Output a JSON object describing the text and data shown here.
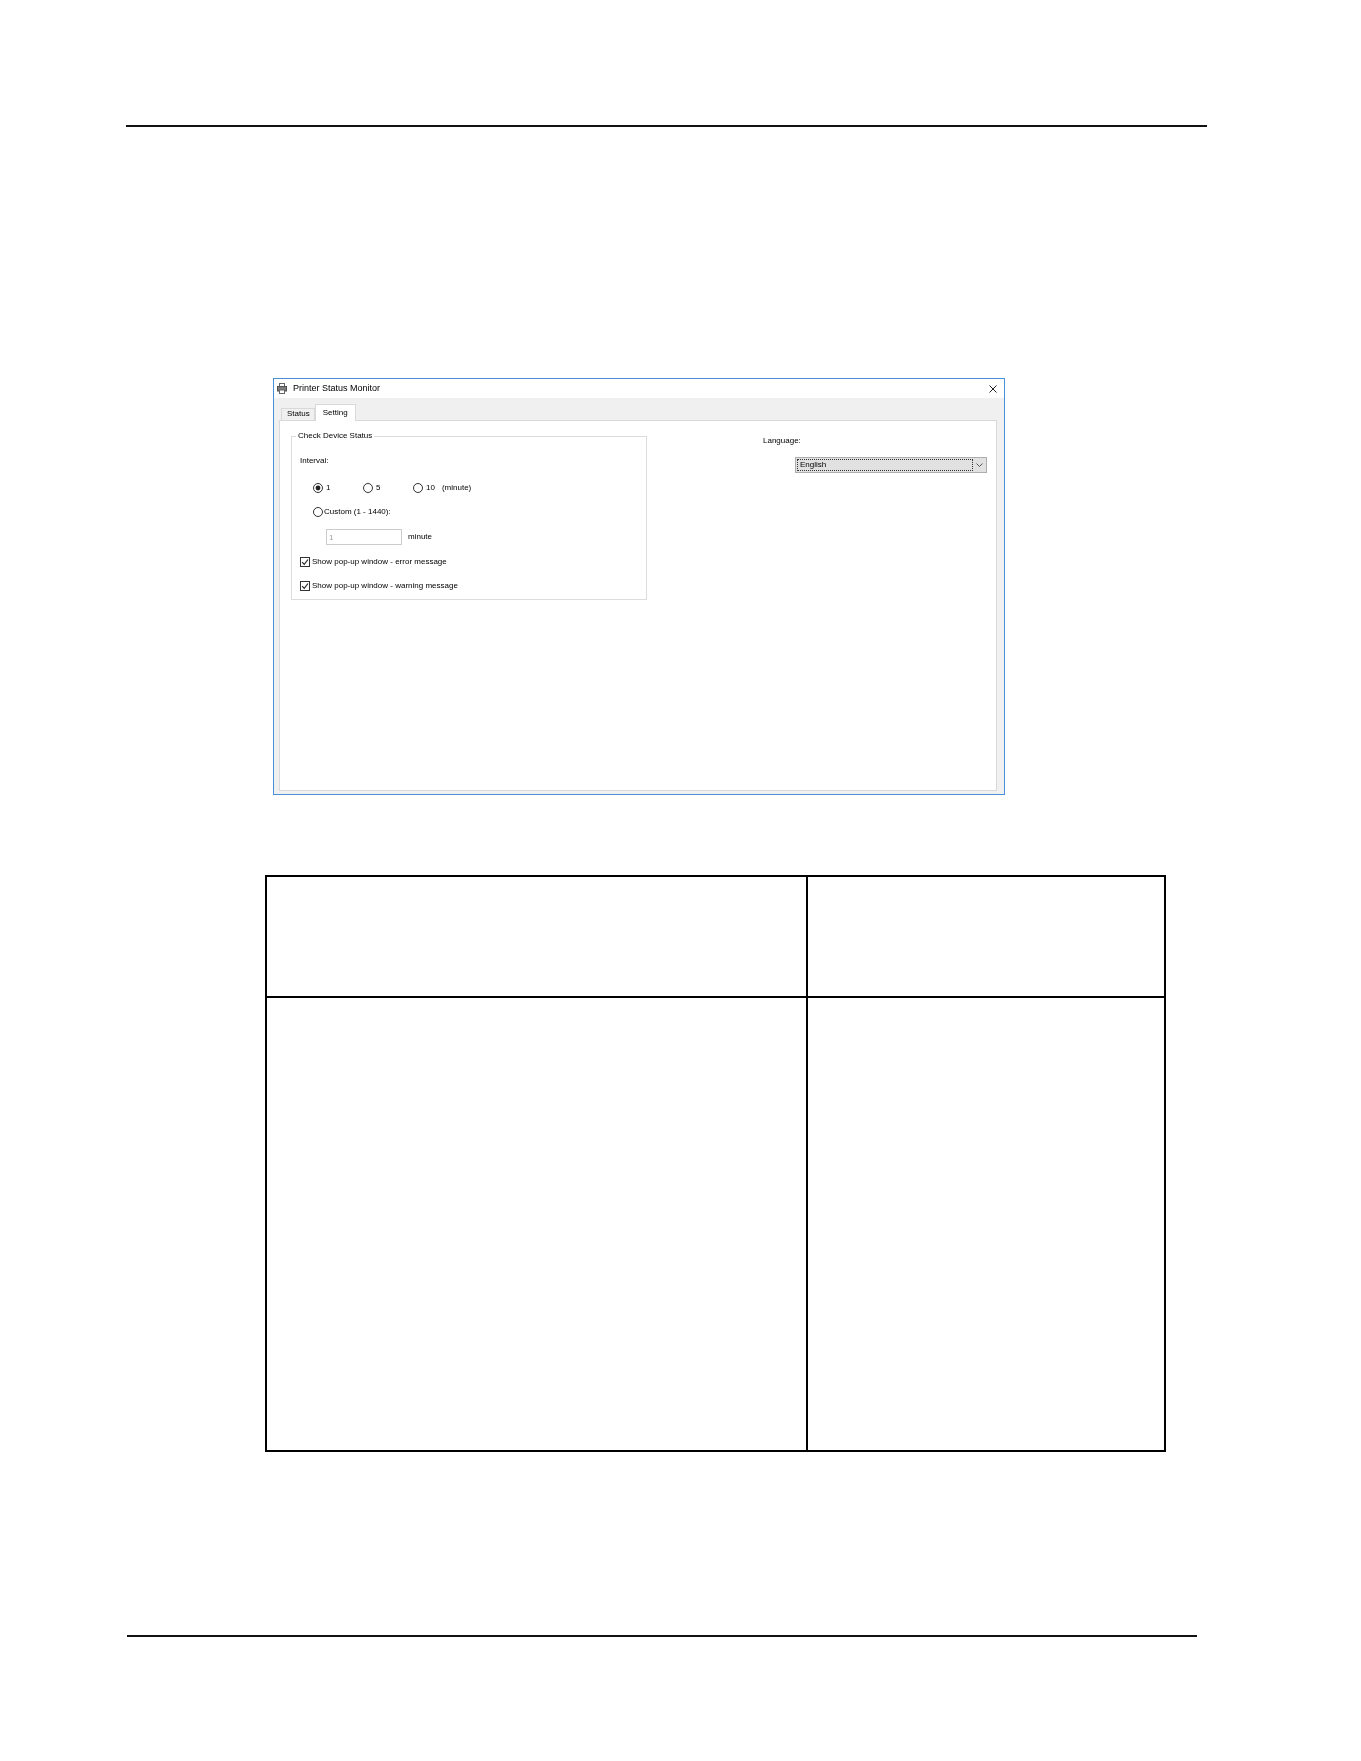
{
  "window": {
    "title": "Printer Status Monitor",
    "tabs": [
      {
        "label": "Status",
        "selected": false
      },
      {
        "label": "Setting",
        "selected": true
      }
    ]
  },
  "check_device_status": {
    "title": "Check Device Status",
    "interval_label": "Interval:",
    "interval_options": [
      {
        "label": "1",
        "selected": true
      },
      {
        "label": "5",
        "selected": false
      },
      {
        "label": "10",
        "selected": false
      }
    ],
    "interval_unit": "(minute)",
    "custom_option": {
      "label": "Custom (1 - 1440):",
      "selected": false
    },
    "custom_field": {
      "value": "1",
      "disabled": true,
      "unit": "minute"
    },
    "checkboxes": [
      {
        "label": "Show pop-up window - error message",
        "checked": true
      },
      {
        "label": "Show pop-up window - warning message",
        "checked": true
      }
    ]
  },
  "language": {
    "label": "Language:",
    "value": "English",
    "focused": true
  }
}
